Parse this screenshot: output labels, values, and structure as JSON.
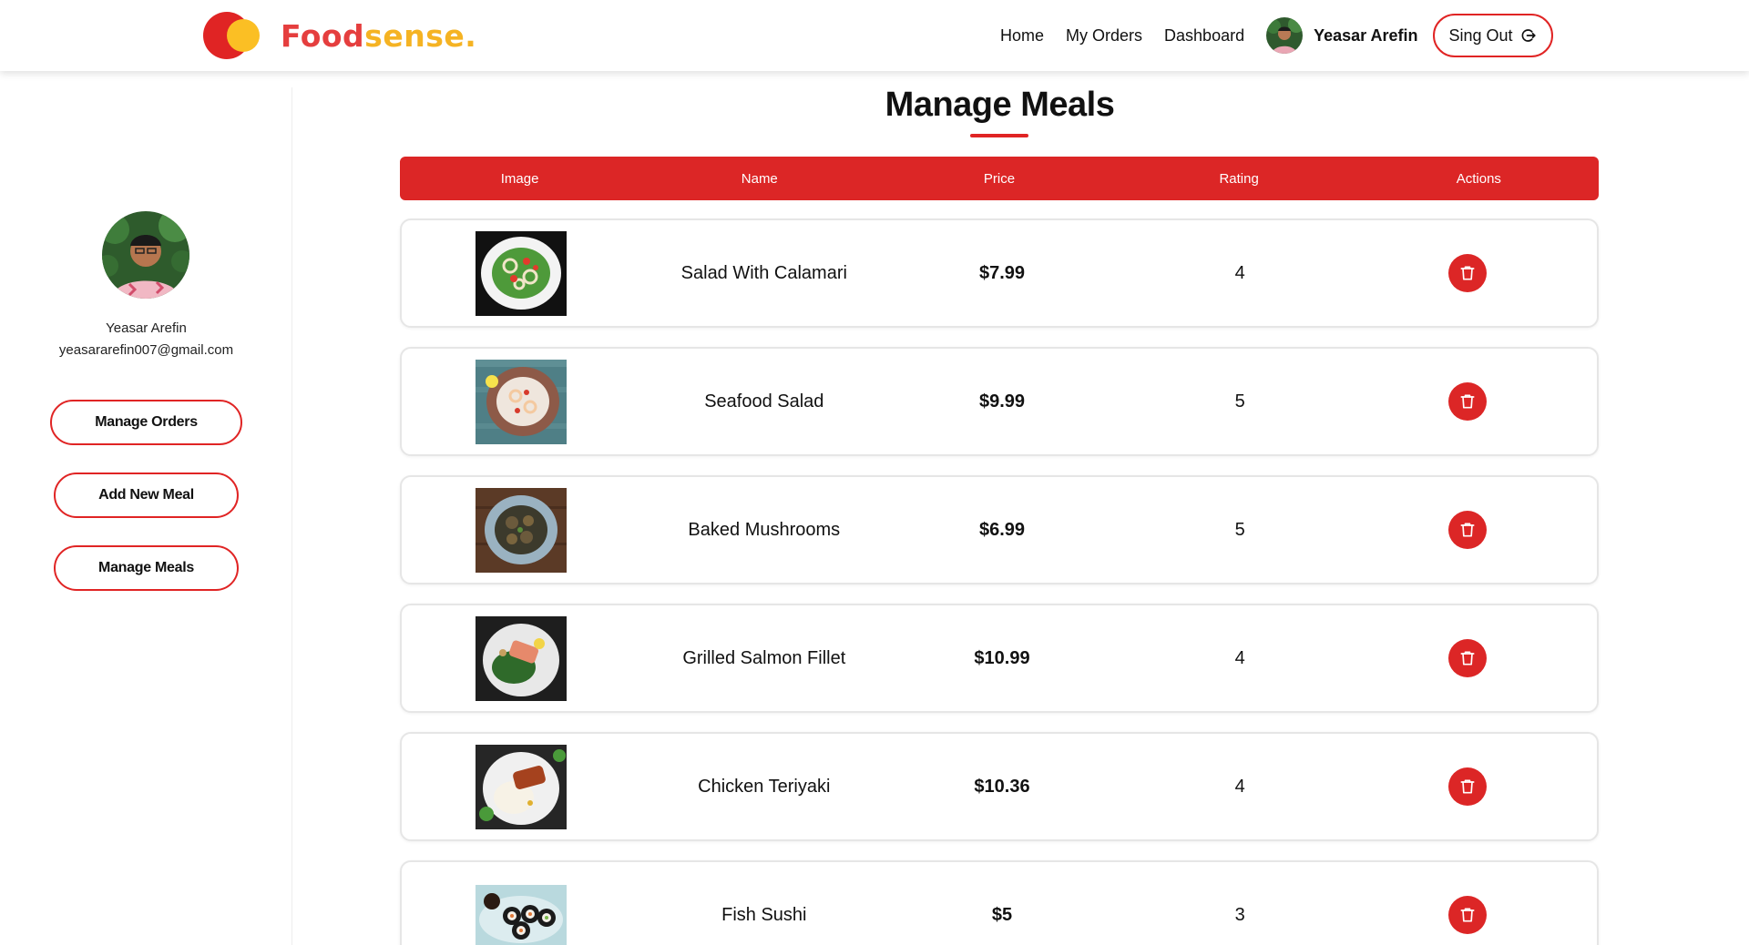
{
  "brand": {
    "part1": "Food",
    "part2": "sense."
  },
  "nav": {
    "links": [
      "Home",
      "My Orders",
      "Dashboard"
    ],
    "username": "Yeasar Arefin",
    "signout_label": "Sing Out"
  },
  "sidebar": {
    "name": "Yeasar Arefin",
    "email": "yeasararefin007@gmail.com",
    "buttons": [
      "Manage Orders",
      "Add New Meal",
      "Manage Meals"
    ]
  },
  "page": {
    "title": "Manage Meals"
  },
  "table": {
    "headers": [
      "Image",
      "Name",
      "Price",
      "Rating",
      "Actions"
    ],
    "rows": [
      {
        "name": "Salad With Calamari",
        "price": "$7.99",
        "rating": "4"
      },
      {
        "name": "Seafood Salad",
        "price": "$9.99",
        "rating": "5"
      },
      {
        "name": "Baked Mushrooms",
        "price": "$6.99",
        "rating": "5"
      },
      {
        "name": "Grilled Salmon Fillet",
        "price": "$10.99",
        "rating": "4"
      },
      {
        "name": "Chicken Teriyaki",
        "price": "$10.36",
        "rating": "4"
      },
      {
        "name": "Fish Sushi",
        "price": "$5",
        "rating": "3"
      }
    ]
  },
  "colors": {
    "accent": "#dc2626",
    "brand_red": "#e53e3e",
    "brand_yellow": "#f5b323"
  },
  "icons": {
    "delete": "trash-icon",
    "signout": "logout-icon"
  }
}
